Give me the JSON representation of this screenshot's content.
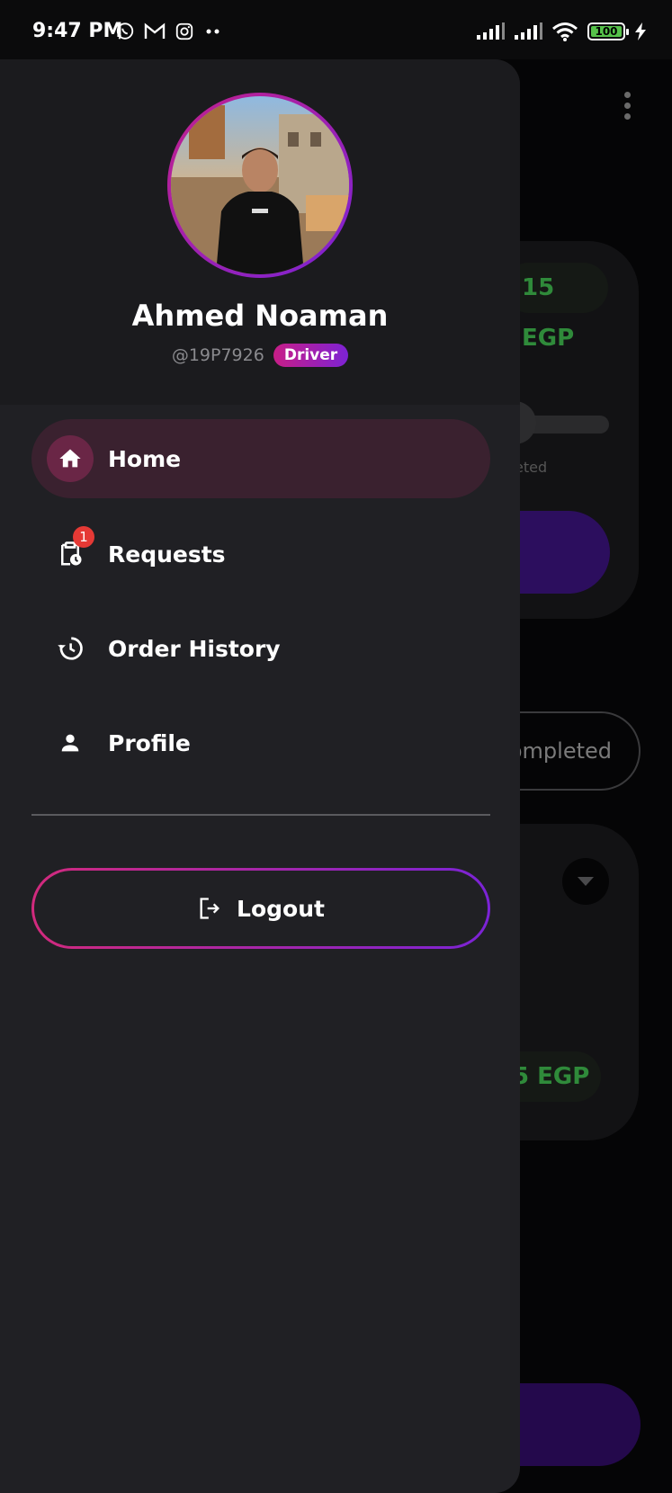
{
  "status_bar": {
    "time": "9:47 PM",
    "app_icons": [
      "whatsapp-icon",
      "gmail-icon",
      "instagram-icon",
      "more-dots-icon"
    ],
    "signal_icons": [
      "signal-icon",
      "signal-icon"
    ],
    "wifi_icon": "wifi-icon",
    "battery_level": "100",
    "charging_icon": "bolt-icon"
  },
  "background_app": {
    "price_top": "15 EGP",
    "progress_caption": "eted",
    "filter_chip": "ompleted",
    "price_bottom": "5 EGP"
  },
  "drawer": {
    "user": {
      "name": "Ahmed Noaman",
      "handle": "@19P7926",
      "role": "Driver"
    },
    "nav_items": [
      {
        "label": "Home",
        "icon": "home-icon",
        "active": true
      },
      {
        "label": "Requests",
        "icon": "clipboard-clock-icon",
        "badge": "1"
      },
      {
        "label": "Order History",
        "icon": "history-icon"
      },
      {
        "label": "Profile",
        "icon": "person-icon"
      }
    ],
    "logout_label": "Logout"
  },
  "colors": {
    "drawer_bg": "#202024",
    "accent_pink": "#c81e87",
    "accent_purple": "#7d22d4",
    "active_item_bg": "#3a212f",
    "badge_red": "#e53935",
    "price_green": "#2f8a3a"
  }
}
